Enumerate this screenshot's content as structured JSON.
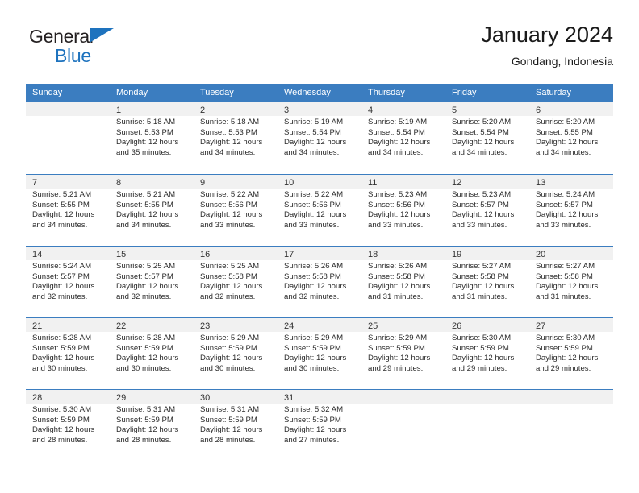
{
  "brand": {
    "name_part1": "General",
    "name_part2": "Blue",
    "triangle_color": "#1e73be"
  },
  "header": {
    "title": "January 2024",
    "subtitle": "Gondang, Indonesia"
  },
  "theme": {
    "header_bg": "#3b7dc0",
    "header_text": "#ffffff",
    "daynum_band": "#f1f1f1",
    "body_text": "#2b2b2b"
  },
  "weekday_headers": [
    "Sunday",
    "Monday",
    "Tuesday",
    "Wednesday",
    "Thursday",
    "Friday",
    "Saturday"
  ],
  "weeks": [
    [
      {
        "day": "",
        "lines": []
      },
      {
        "day": "1",
        "lines": [
          "Sunrise: 5:18 AM",
          "Sunset: 5:53 PM",
          "Daylight: 12 hours",
          "and 35 minutes."
        ]
      },
      {
        "day": "2",
        "lines": [
          "Sunrise: 5:18 AM",
          "Sunset: 5:53 PM",
          "Daylight: 12 hours",
          "and 34 minutes."
        ]
      },
      {
        "day": "3",
        "lines": [
          "Sunrise: 5:19 AM",
          "Sunset: 5:54 PM",
          "Daylight: 12 hours",
          "and 34 minutes."
        ]
      },
      {
        "day": "4",
        "lines": [
          "Sunrise: 5:19 AM",
          "Sunset: 5:54 PM",
          "Daylight: 12 hours",
          "and 34 minutes."
        ]
      },
      {
        "day": "5",
        "lines": [
          "Sunrise: 5:20 AM",
          "Sunset: 5:54 PM",
          "Daylight: 12 hours",
          "and 34 minutes."
        ]
      },
      {
        "day": "6",
        "lines": [
          "Sunrise: 5:20 AM",
          "Sunset: 5:55 PM",
          "Daylight: 12 hours",
          "and 34 minutes."
        ]
      }
    ],
    [
      {
        "day": "7",
        "lines": [
          "Sunrise: 5:21 AM",
          "Sunset: 5:55 PM",
          "Daylight: 12 hours",
          "and 34 minutes."
        ]
      },
      {
        "day": "8",
        "lines": [
          "Sunrise: 5:21 AM",
          "Sunset: 5:55 PM",
          "Daylight: 12 hours",
          "and 34 minutes."
        ]
      },
      {
        "day": "9",
        "lines": [
          "Sunrise: 5:22 AM",
          "Sunset: 5:56 PM",
          "Daylight: 12 hours",
          "and 33 minutes."
        ]
      },
      {
        "day": "10",
        "lines": [
          "Sunrise: 5:22 AM",
          "Sunset: 5:56 PM",
          "Daylight: 12 hours",
          "and 33 minutes."
        ]
      },
      {
        "day": "11",
        "lines": [
          "Sunrise: 5:23 AM",
          "Sunset: 5:56 PM",
          "Daylight: 12 hours",
          "and 33 minutes."
        ]
      },
      {
        "day": "12",
        "lines": [
          "Sunrise: 5:23 AM",
          "Sunset: 5:57 PM",
          "Daylight: 12 hours",
          "and 33 minutes."
        ]
      },
      {
        "day": "13",
        "lines": [
          "Sunrise: 5:24 AM",
          "Sunset: 5:57 PM",
          "Daylight: 12 hours",
          "and 33 minutes."
        ]
      }
    ],
    [
      {
        "day": "14",
        "lines": [
          "Sunrise: 5:24 AM",
          "Sunset: 5:57 PM",
          "Daylight: 12 hours",
          "and 32 minutes."
        ]
      },
      {
        "day": "15",
        "lines": [
          "Sunrise: 5:25 AM",
          "Sunset: 5:57 PM",
          "Daylight: 12 hours",
          "and 32 minutes."
        ]
      },
      {
        "day": "16",
        "lines": [
          "Sunrise: 5:25 AM",
          "Sunset: 5:58 PM",
          "Daylight: 12 hours",
          "and 32 minutes."
        ]
      },
      {
        "day": "17",
        "lines": [
          "Sunrise: 5:26 AM",
          "Sunset: 5:58 PM",
          "Daylight: 12 hours",
          "and 32 minutes."
        ]
      },
      {
        "day": "18",
        "lines": [
          "Sunrise: 5:26 AM",
          "Sunset: 5:58 PM",
          "Daylight: 12 hours",
          "and 31 minutes."
        ]
      },
      {
        "day": "19",
        "lines": [
          "Sunrise: 5:27 AM",
          "Sunset: 5:58 PM",
          "Daylight: 12 hours",
          "and 31 minutes."
        ]
      },
      {
        "day": "20",
        "lines": [
          "Sunrise: 5:27 AM",
          "Sunset: 5:58 PM",
          "Daylight: 12 hours",
          "and 31 minutes."
        ]
      }
    ],
    [
      {
        "day": "21",
        "lines": [
          "Sunrise: 5:28 AM",
          "Sunset: 5:59 PM",
          "Daylight: 12 hours",
          "and 30 minutes."
        ]
      },
      {
        "day": "22",
        "lines": [
          "Sunrise: 5:28 AM",
          "Sunset: 5:59 PM",
          "Daylight: 12 hours",
          "and 30 minutes."
        ]
      },
      {
        "day": "23",
        "lines": [
          "Sunrise: 5:29 AM",
          "Sunset: 5:59 PM",
          "Daylight: 12 hours",
          "and 30 minutes."
        ]
      },
      {
        "day": "24",
        "lines": [
          "Sunrise: 5:29 AM",
          "Sunset: 5:59 PM",
          "Daylight: 12 hours",
          "and 30 minutes."
        ]
      },
      {
        "day": "25",
        "lines": [
          "Sunrise: 5:29 AM",
          "Sunset: 5:59 PM",
          "Daylight: 12 hours",
          "and 29 minutes."
        ]
      },
      {
        "day": "26",
        "lines": [
          "Sunrise: 5:30 AM",
          "Sunset: 5:59 PM",
          "Daylight: 12 hours",
          "and 29 minutes."
        ]
      },
      {
        "day": "27",
        "lines": [
          "Sunrise: 5:30 AM",
          "Sunset: 5:59 PM",
          "Daylight: 12 hours",
          "and 29 minutes."
        ]
      }
    ],
    [
      {
        "day": "28",
        "lines": [
          "Sunrise: 5:30 AM",
          "Sunset: 5:59 PM",
          "Daylight: 12 hours",
          "and 28 minutes."
        ]
      },
      {
        "day": "29",
        "lines": [
          "Sunrise: 5:31 AM",
          "Sunset: 5:59 PM",
          "Daylight: 12 hours",
          "and 28 minutes."
        ]
      },
      {
        "day": "30",
        "lines": [
          "Sunrise: 5:31 AM",
          "Sunset: 5:59 PM",
          "Daylight: 12 hours",
          "and 28 minutes."
        ]
      },
      {
        "day": "31",
        "lines": [
          "Sunrise: 5:32 AM",
          "Sunset: 5:59 PM",
          "Daylight: 12 hours",
          "and 27 minutes."
        ]
      },
      {
        "day": "",
        "lines": []
      },
      {
        "day": "",
        "lines": []
      },
      {
        "day": "",
        "lines": []
      }
    ]
  ]
}
